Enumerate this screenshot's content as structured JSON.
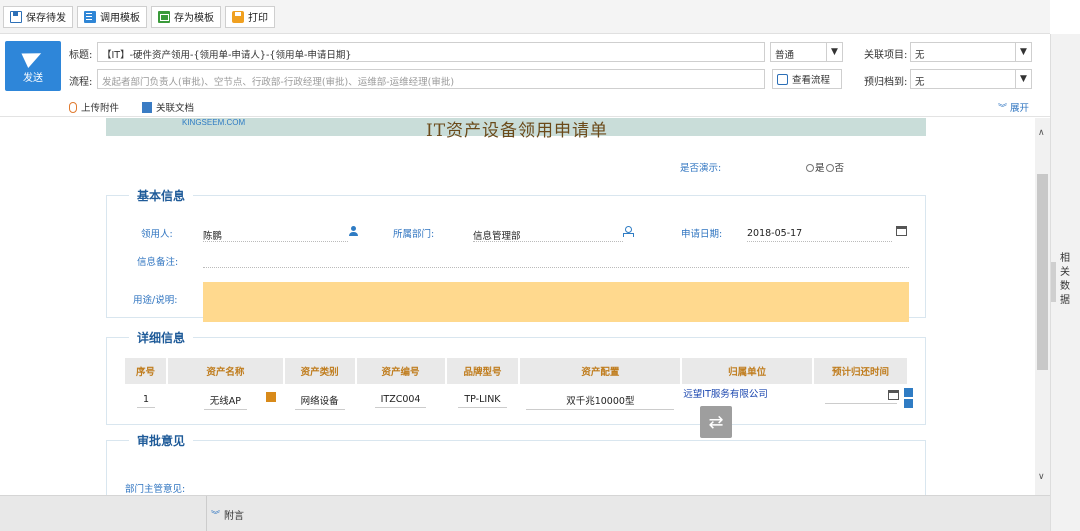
{
  "toolbar": {
    "buttons": [
      {
        "label": "保存待发",
        "icon": "save-icon"
      },
      {
        "label": "调用模板",
        "icon": "template-icon"
      },
      {
        "label": "存为模板",
        "icon": "save-template-icon"
      },
      {
        "label": "打印",
        "icon": "print-icon"
      }
    ]
  },
  "header": {
    "send_label": "发送",
    "title_label": "标题:",
    "title_value": "【IT】-硬件资产领用-{领用单-申请人}-{领用单-申请日期}",
    "priority": "普通",
    "related_project_label": "关联项目:",
    "related_project_value": "无",
    "flow_label": "流程:",
    "flow_placeholder": "发起者部门负责人(审批)、空节点、行政部-行政经理(审批)、运维部-运维经理(审批)",
    "view_flow_label": "查看流程",
    "archive_label": "预归档到:",
    "archive_value": "无",
    "upload_label": "上传附件",
    "related_doc_label": "关联文档",
    "expand_label": "展开"
  },
  "form": {
    "brand": "KINGSEEM.COM",
    "title": "IT资产设备领用申请单",
    "demo_label": "是否演示:",
    "demo_yes": "是",
    "demo_no": "否",
    "basic": {
      "section_title": "基本信息",
      "applicant_label": "领用人:",
      "applicant_value": "陈鹏",
      "dept_label": "所属部门:",
      "dept_value": "信息管理部",
      "date_label": "申请日期:",
      "date_value": "2018-05-17",
      "remark_label": "信息备注:",
      "purpose_label": "用途/说明:"
    },
    "detail": {
      "section_title": "详细信息",
      "columns": [
        "序号",
        "资产名称",
        "资产类别",
        "资产编号",
        "品牌型号",
        "资产配置",
        "归属单位",
        "预计归还时间"
      ],
      "row": {
        "no": "1",
        "name": "无线AP",
        "category": "网络设备",
        "code": "ITZC004",
        "brand": "TP-LINK",
        "config": "双千兆10000型",
        "unit": "远望IT服务有限公司",
        "return_time": ""
      }
    },
    "approval": {
      "section_title": "审批意见",
      "dept_head_label": "部门主管意见:"
    }
  },
  "right_panel": {
    "label": "相关数据"
  },
  "bottom": {
    "attachment_label": "附言"
  }
}
